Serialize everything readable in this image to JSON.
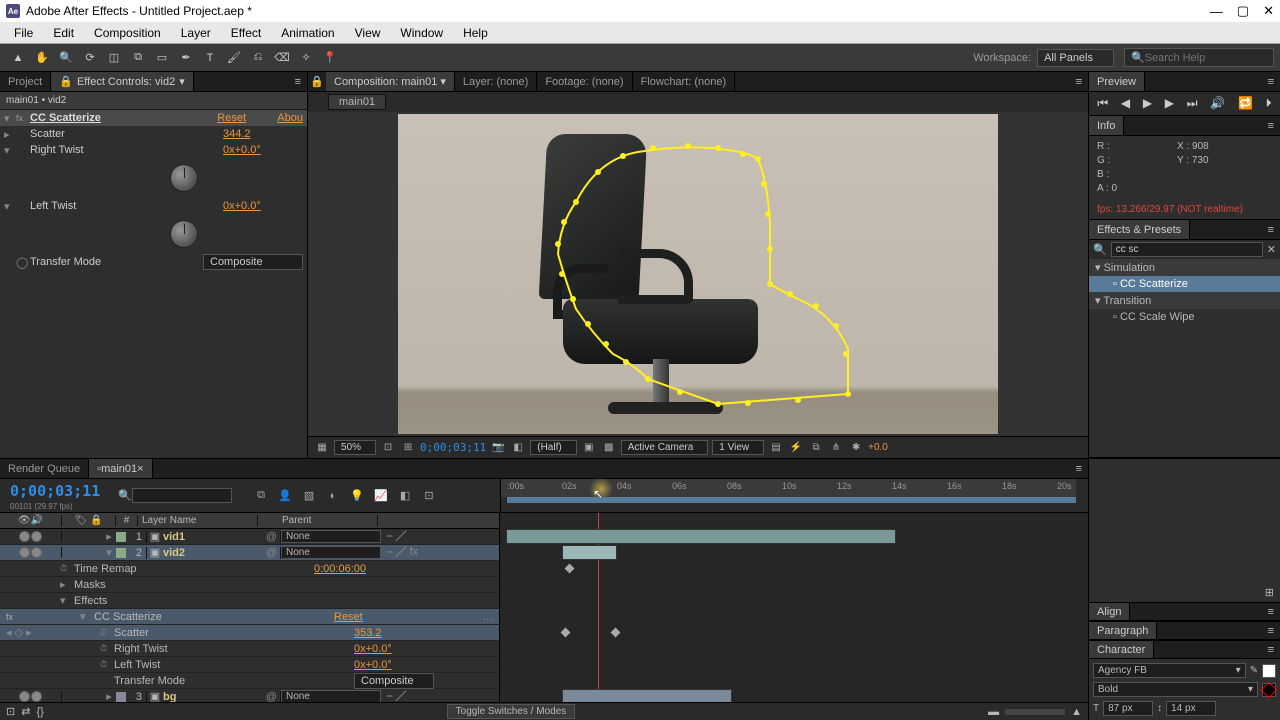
{
  "titlebar": {
    "text": "Adobe After Effects - Untitled Project.aep *"
  },
  "menubar": [
    "File",
    "Edit",
    "Composition",
    "Layer",
    "Effect",
    "Animation",
    "View",
    "Window",
    "Help"
  ],
  "toolbar": {
    "workspace_label": "Workspace:",
    "workspace_value": "All Panels",
    "search_placeholder": "Search Help"
  },
  "leftPanel": {
    "tabs": {
      "project": "Project",
      "effectControls": "Effect Controls: vid2"
    },
    "breadcrumb": "main01 • vid2",
    "effect": {
      "name": "CC Scatterize",
      "reset": "Reset",
      "about": "Abou",
      "props": [
        {
          "name": "Scatter",
          "value": "344.2",
          "dial": false
        },
        {
          "name": "Right Twist",
          "value": "0x+0.0°",
          "dial": true
        },
        {
          "name": "Left Twist",
          "value": "0x+0.0°",
          "dial": true
        },
        {
          "name": "Transfer Mode",
          "value": "Composite",
          "dial": false,
          "dd": true
        }
      ]
    }
  },
  "centerPanel": {
    "tabs": {
      "comp": "Composition: main01",
      "layer": "Layer: (none)",
      "footage": "Footage: (none)",
      "flowchart": "Flowchart: (none)"
    },
    "subtab": "main01",
    "footer": {
      "zoom": "50%",
      "timecode": "0;00;03;11",
      "res": "(Half)",
      "camera": "Active Camera",
      "view": "1 View",
      "exposure": "+0.0"
    }
  },
  "rightPanel": {
    "preview": {
      "title": "Preview"
    },
    "info": {
      "title": "Info",
      "R": "R :",
      "G": "G :",
      "B": "B :",
      "A": "A :  0",
      "X": "X : 908",
      "Y": "Y : 730",
      "fps": "fps: 13.266/29.97  (NOT realtime)"
    },
    "effectsPresets": {
      "title": "Effects & Presets",
      "search": "cc sc",
      "cats": [
        {
          "name": "Simulation",
          "items": [
            {
              "name": "CC Scatterize",
              "sel": true
            }
          ]
        },
        {
          "name": "Transition",
          "items": [
            {
              "name": "CC Scale Wipe",
              "sel": false
            }
          ]
        }
      ]
    },
    "align": {
      "title": "Align"
    },
    "paragraph": {
      "title": "Paragraph"
    },
    "character": {
      "title": "Character",
      "font": "Agency FB",
      "style": "Bold",
      "sizeIcon": "T",
      "size": "87 px",
      "leadIcon": "↕",
      "lead": "14 px"
    }
  },
  "timeline": {
    "tabs": {
      "rq": "Render Queue",
      "comp": "main01"
    },
    "timecode": "0;00;03;11",
    "subcode": "00101 (29.97 fps)",
    "ticks": [
      ":00s",
      "02s",
      "04s",
      "06s",
      "08s",
      "10s",
      "12s",
      "14s",
      "16s",
      "18s",
      "20s"
    ],
    "cols": {
      "num": "#",
      "layerName": "Layer Name",
      "parent": "Parent"
    },
    "layers": [
      {
        "num": "1",
        "name": "vid1",
        "parent": "None"
      },
      {
        "num": "2",
        "name": "vid2",
        "parent": "None",
        "sel": true
      },
      {
        "num": "3",
        "name": "bg",
        "parent": "None"
      }
    ],
    "props": {
      "timeRemap": {
        "name": "Time Remap",
        "value": "0:00:06:00"
      },
      "masks": "Masks",
      "effects": "Effects",
      "ccscatter": {
        "name": "CC Scatterize",
        "reset": "Reset"
      },
      "scatter": {
        "name": "Scatter",
        "value": "353.2"
      },
      "rtwist": {
        "name": "Right Twist",
        "value": "0x+0.0°"
      },
      "ltwist": {
        "name": "Left Twist",
        "value": "0x+0.0°"
      },
      "tmode": {
        "name": "Transfer Mode",
        "value": "Composite"
      }
    },
    "toggle": "Toggle Switches / Modes"
  }
}
